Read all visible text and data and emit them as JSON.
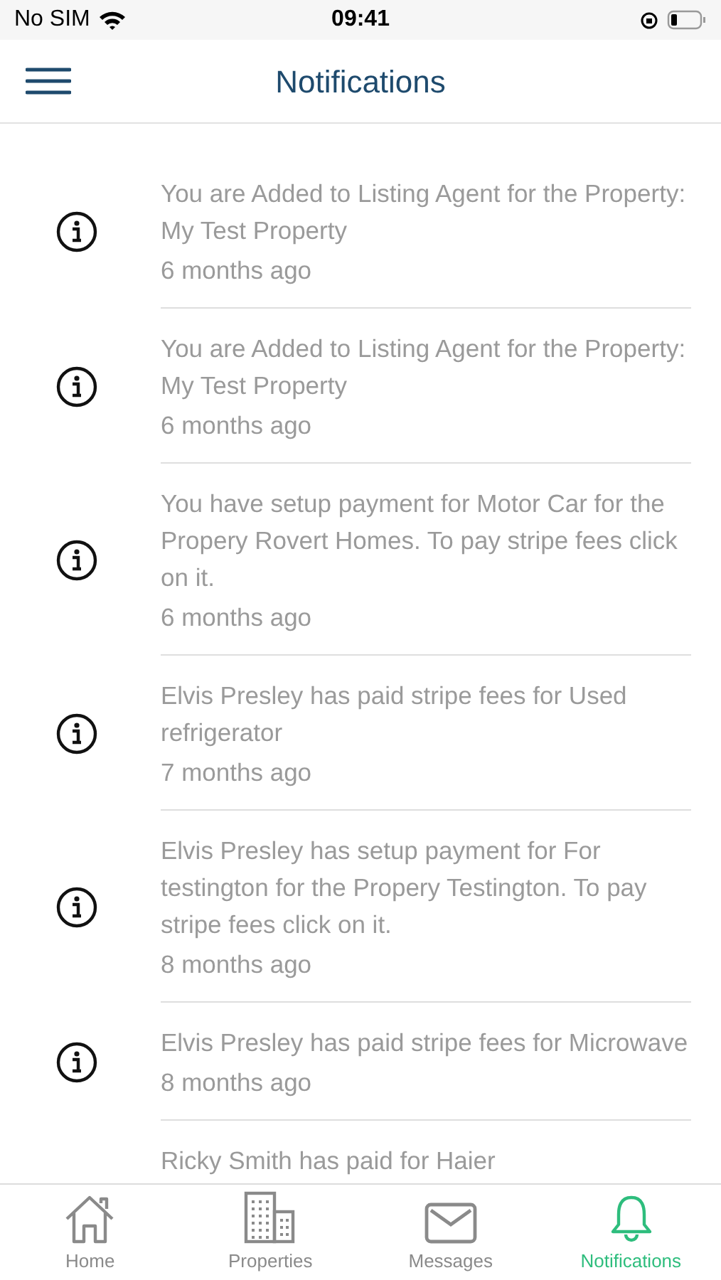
{
  "status_bar": {
    "carrier": "No SIM",
    "time": "09:41"
  },
  "header": {
    "title": "Notifications"
  },
  "notifications": [
    {
      "message": "You are Added to Listing Agent for the Property: My Test Property",
      "time": "6 months ago"
    },
    {
      "message": "You are Added to Listing Agent for the Property: My Test Property",
      "time": "6 months ago"
    },
    {
      "message": "You have setup payment for Motor Car for the Propery Rovert Homes. To pay stripe fees click on it.",
      "time": "6 months ago"
    },
    {
      "message": "Elvis Presley has paid stripe fees for Used refrigerator",
      "time": "7 months ago"
    },
    {
      "message": "Elvis Presley has setup payment for For testington for the Propery Testington. To pay stripe fees click on it.",
      "time": "8 months ago"
    },
    {
      "message": "Elvis Presley has paid stripe fees for Microwave",
      "time": "8 months ago"
    },
    {
      "message": "Ricky Smith has paid for Haier"
    }
  ],
  "tab_bar": [
    {
      "kind": "home",
      "label": "Home",
      "selected": false
    },
    {
      "kind": "properties",
      "label": "Properties",
      "selected": false
    },
    {
      "kind": "messages",
      "label": "Messages",
      "selected": false
    },
    {
      "kind": "notifications",
      "label": "Notifications",
      "selected": true
    }
  ]
}
